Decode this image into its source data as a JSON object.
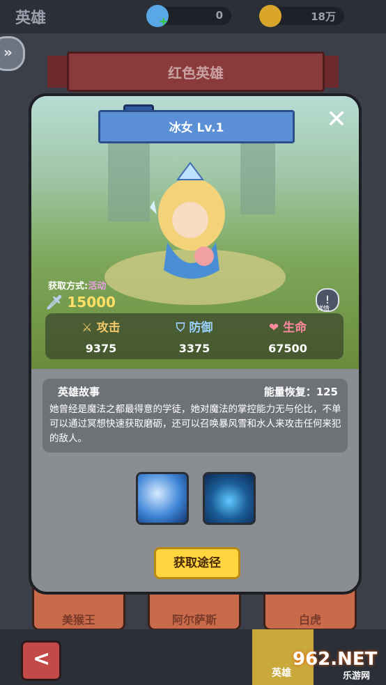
{
  "top_bar": {
    "title": "英雄",
    "gems": "0",
    "coins": "18万",
    "gem_icon": "gem-plus-icon",
    "coin_icon": "coin-icon"
  },
  "side_button_icon": "double-chevron-right-icon",
  "ribbon": {
    "title": "红色英雄"
  },
  "hero_modal": {
    "title": "冰女 Lv.1",
    "badge_icon": "staff-icon",
    "close_icon": "close-icon",
    "obtain_label": "获取方式:",
    "obtain_value": "活动",
    "power": "15000",
    "detail_label": "详情",
    "stats": [
      {
        "label": "攻击",
        "value": "9375",
        "icon": "crossed-swords-icon",
        "color": "#f2c96a"
      },
      {
        "label": "防御",
        "value": "3375",
        "icon": "shield-icon",
        "color": "#9ad2ff"
      },
      {
        "label": "生命",
        "value": "67500",
        "icon": "heart-icon",
        "color": "#ff8aa0"
      }
    ],
    "story": {
      "title": "英雄故事",
      "energy": "能量恢复：125",
      "text": "她曾经是魔法之都最得意的学徒，她对魔法的掌控能力无与伦比，不单可以通过冥想快速获取磨砺，还可以召唤暴风雪和水人来攻击任何来犯的敌人。"
    },
    "skills": [
      {
        "icon": "blizzard-skill-icon"
      },
      {
        "icon": "ice-totem-skill-icon"
      }
    ],
    "get_button": "获取途径"
  },
  "behind_cards": [
    "美猴王",
    "阿尔萨斯",
    "白虎"
  ],
  "bottom_bar": {
    "back_icon": "back-arrow-icon",
    "tab_label": "英雄"
  },
  "watermark": {
    "main": "962.NET",
    "sub": "乐游网"
  }
}
